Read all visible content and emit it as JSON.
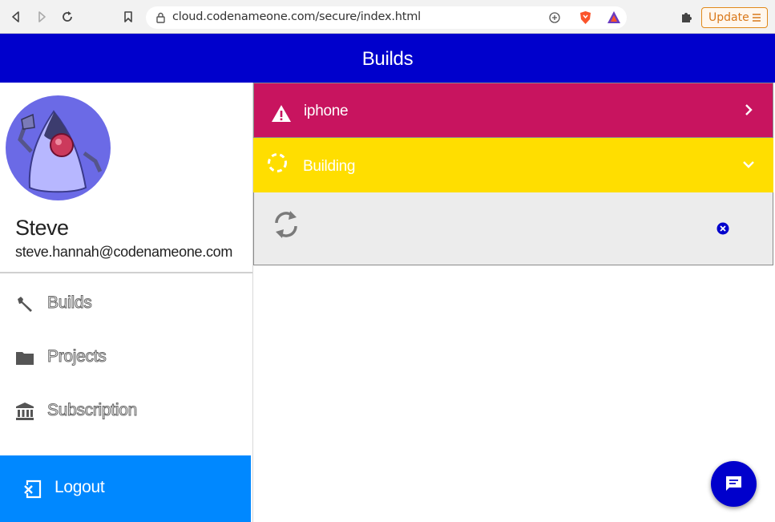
{
  "browser": {
    "url": "cloud.codenameone.com/secure/index.html",
    "update_label": "Update"
  },
  "header": {
    "title": "Builds"
  },
  "user": {
    "name": "Steve",
    "email": "steve.hannah@codenameone.com"
  },
  "sidebar": {
    "items": [
      {
        "label": "Builds",
        "icon": "wrench-icon"
      },
      {
        "label": "Projects",
        "icon": "folder-icon"
      },
      {
        "label": "Subscription",
        "icon": "bank-icon"
      }
    ],
    "logout_label": "Logout"
  },
  "builds": [
    {
      "label": "iphone",
      "status": "error",
      "color": "#c8145f",
      "icon": "warning-icon"
    },
    {
      "label": "Building",
      "status": "building",
      "color": "#ffde00",
      "icon": "dashed-circle-icon"
    }
  ],
  "colors": {
    "header": "#0000cc",
    "logout": "#0088ff",
    "fab": "#0000cc"
  }
}
